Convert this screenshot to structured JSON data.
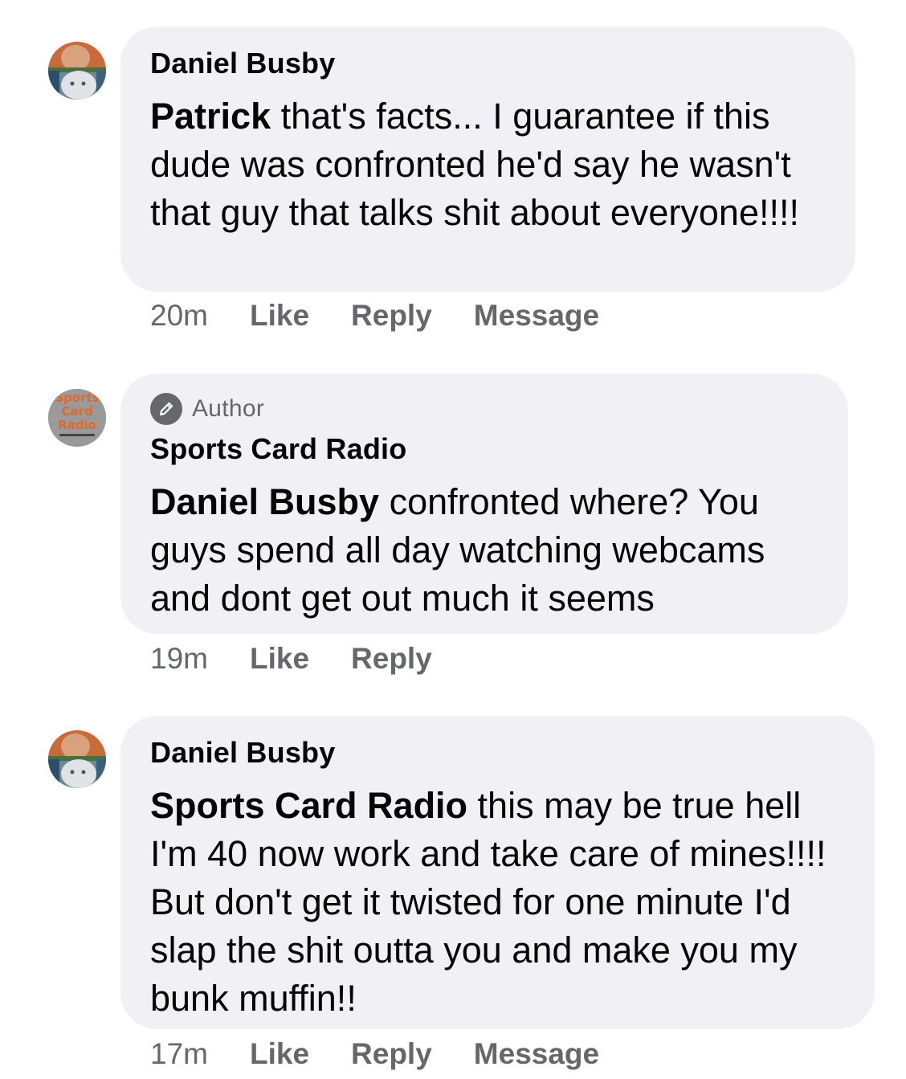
{
  "comments": [
    {
      "author": "Daniel Busby",
      "mention": "Patrick",
      "text": " that's facts... I guarantee if this dude was confronted he'd say he wasn't that guy that talks shit about everyone!!!!",
      "time": "20m",
      "like": "Like",
      "reply": "Reply",
      "message": "Message"
    },
    {
      "badge": "Author",
      "author": "Sports Card Radio",
      "mention": "Daniel Busby",
      "text": " confronted where? You guys spend all day watching webcams and dont get out much it seems",
      "time": "19m",
      "like": "Like",
      "reply": "Reply"
    },
    {
      "author": "Daniel Busby",
      "mention": "Sports Card Radio",
      "text": " this may be true hell I'm 40 now work and take care of mines!!!! But don't get it twisted for one minute I'd slap the shit outta you and make you my bunk muffin!!",
      "time": "17m",
      "like": "Like",
      "reply": "Reply",
      "message": "Message"
    }
  ],
  "avatars": {
    "sports_card_radio_logo_text": [
      "Sports",
      "Card",
      "Radio"
    ]
  },
  "icons": {
    "author_badge": "pencil-icon"
  },
  "colors": {
    "bubble": "#f0f0f5",
    "secondary_text": "#65676b",
    "primary_text": "#050505"
  }
}
